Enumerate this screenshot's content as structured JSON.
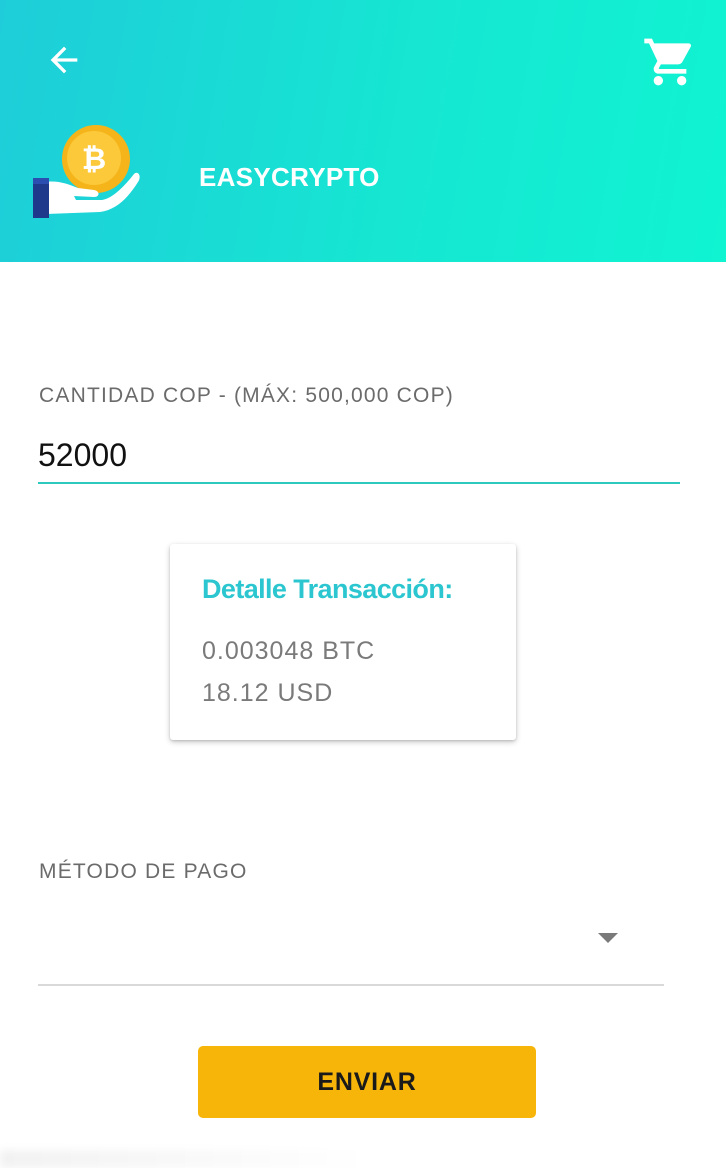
{
  "header": {
    "title": "EASYCRYPTO",
    "back_icon": "arrow-back-icon",
    "cart_icon": "shopping-cart-icon",
    "logo_icon": "bitcoin-hand-logo",
    "logo_glyph": "₿",
    "gradient_colors": [
      "#1ecdd9",
      "#10f4d2"
    ]
  },
  "amount": {
    "label": "CANTIDAD COP - (MÁX: 500,000 COP)",
    "value": "52000",
    "underline_color": "#2cc9bf"
  },
  "transaction_detail": {
    "title": "Detalle Transacción:",
    "btc_amount": "0.003048 BTC",
    "usd_amount": "18.12 USD",
    "title_color": "#2bc6cf"
  },
  "payment": {
    "label": "MÉTODO DE PAGO",
    "selected_value": "",
    "dropdown_icon": "dropdown-arrow-icon"
  },
  "actions": {
    "send_label": "ENVIAR",
    "send_color": "#f7b50a"
  }
}
